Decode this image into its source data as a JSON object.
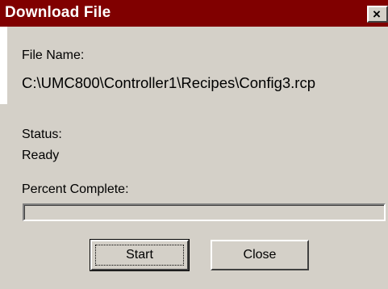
{
  "dialog": {
    "title": "Download File",
    "close_glyph": "×",
    "file_name_label": "File Name:",
    "file_name_value": "C:\\UMC800\\Controller1\\Recipes\\Config3.rcp",
    "status_label": "Status:",
    "status_value": "Ready",
    "percent_label": "Percent Complete:",
    "percent_complete": 0,
    "buttons": {
      "start": "Start",
      "close": "Close"
    }
  },
  "colors": {
    "titlebar": "#800000",
    "face": "#d4d0c8"
  }
}
